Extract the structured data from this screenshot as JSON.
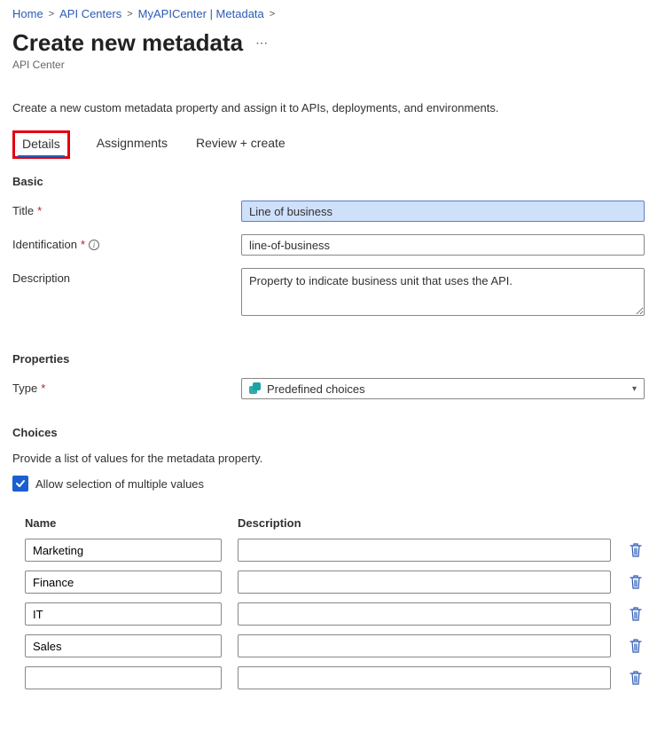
{
  "breadcrumb": {
    "items": [
      "Home",
      "API Centers",
      "MyAPICenter | Metadata"
    ]
  },
  "header": {
    "title": "Create new metadata",
    "subtitle": "API Center"
  },
  "intro": "Create a new custom metadata property and assign it to APIs, deployments, and environments.",
  "tabs": {
    "details": "Details",
    "assignments": "Assignments",
    "review": "Review + create"
  },
  "sections": {
    "basic": "Basic",
    "properties": "Properties",
    "choices": "Choices"
  },
  "form": {
    "title_label": "Title",
    "title_value": "Line of business",
    "identification_label": "Identification",
    "identification_value": "line-of-business",
    "description_label": "Description",
    "description_value": "Property to indicate business unit that uses the API.",
    "type_label": "Type",
    "type_value": "Predefined choices"
  },
  "choices": {
    "intro": "Provide a list of values for the metadata property.",
    "allow_multi_label": "Allow selection of multiple values",
    "col_name": "Name",
    "col_desc": "Description",
    "rows": [
      {
        "name": "Marketing",
        "desc": ""
      },
      {
        "name": "Finance",
        "desc": ""
      },
      {
        "name": "IT",
        "desc": ""
      },
      {
        "name": "Sales",
        "desc": ""
      },
      {
        "name": "",
        "desc": ""
      }
    ]
  }
}
